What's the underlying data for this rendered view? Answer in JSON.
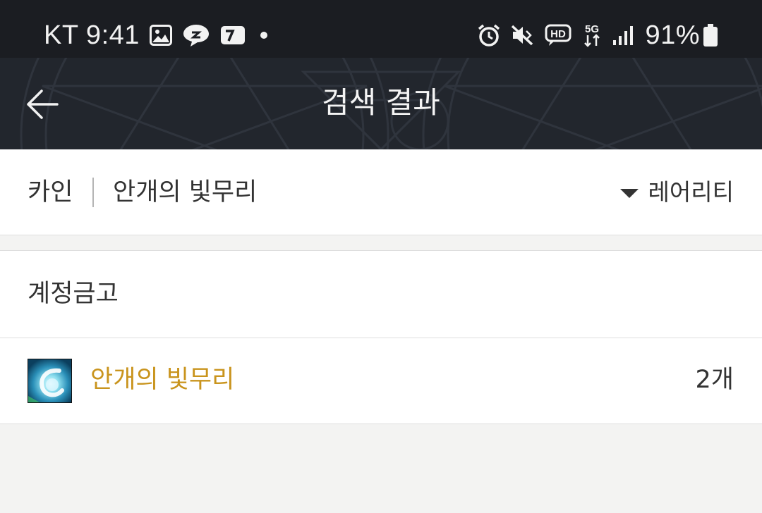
{
  "status_bar": {
    "carrier_time": "KT 9:41",
    "battery": "91%",
    "icons_left": [
      "gallery-icon",
      "messenger-icon",
      "notification-app-icon",
      "more-dot-icon"
    ],
    "icons_right": [
      "alarm-icon",
      "mute-icon",
      "hd-voice-icon",
      "5g-icon",
      "signal-icon",
      "battery-icon"
    ]
  },
  "header": {
    "title": "검색 결과",
    "back_icon": "arrow-left-icon"
  },
  "filter": {
    "server": "카인",
    "item": "안개의 빛무리",
    "sort_label": "레어리티",
    "sort_icon": "caret-down-icon"
  },
  "section": {
    "title": "계정금고"
  },
  "results": [
    {
      "name": "안개의 빛무리",
      "count": "2개",
      "name_color": "#c9941d"
    }
  ],
  "colors": {
    "status_bg": "#1b1d22",
    "header_bg": "#22262d",
    "accent_gold": "#c9941d",
    "page_bg": "#f3f3f2"
  }
}
